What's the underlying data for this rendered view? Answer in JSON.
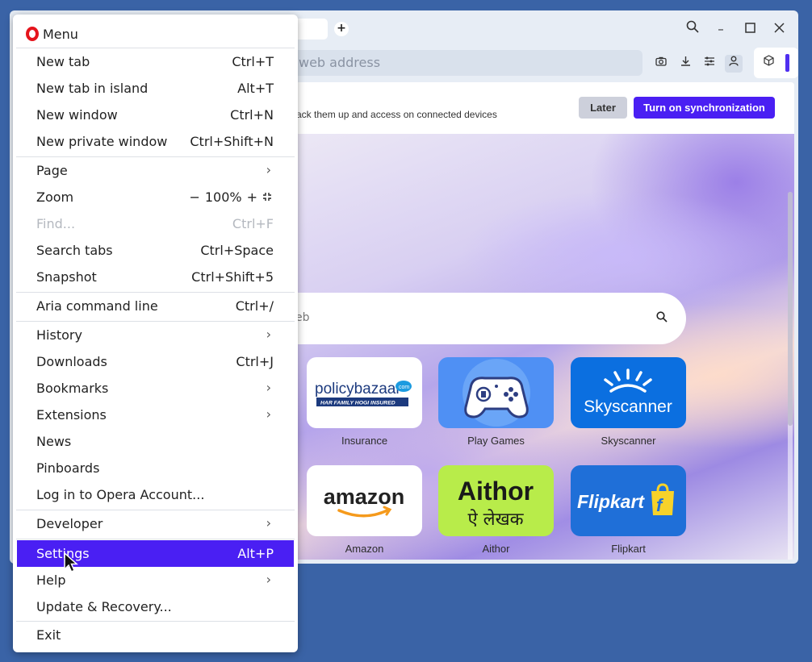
{
  "address_bar": {
    "placeholder": "web address"
  },
  "window_controls": {
    "search": "⌕",
    "minimize": "–",
    "maximize": "☐",
    "close": "✕"
  },
  "new_tab_symbol": "+",
  "sync_banner": {
    "text": "ack them up and access on connected devices",
    "later": "Later",
    "turn_on": "Turn on synchronization"
  },
  "search": {
    "placeholder": "eb"
  },
  "speed_dial": [
    {
      "label": "Insurance",
      "logo": "policybazaar",
      "logo_sub": "HAR FAMILY HOGI INSURED",
      "logo_com": "com"
    },
    {
      "label": "Play Games",
      "logo": "gamepad"
    },
    {
      "label": "Skyscanner",
      "logo": "Skyscanner"
    },
    {
      "label": "Amazon",
      "logo": "amazon"
    },
    {
      "label": "Aithor",
      "logo": "Aithor",
      "logo_sub": "ऐ लेखक"
    },
    {
      "label": "Flipkart",
      "logo": "Flipkart"
    }
  ],
  "menu": {
    "title": "Menu",
    "items": [
      {
        "label": "New tab",
        "shortcut": "Ctrl+T"
      },
      {
        "label": "New tab in island",
        "shortcut": "Alt+T"
      },
      {
        "label": "New window",
        "shortcut": "Ctrl+N"
      },
      {
        "label": "New private window",
        "shortcut": "Ctrl+Shift+N"
      },
      {
        "label": "Page",
        "shortcut": ""
      },
      {
        "label": "Zoom",
        "shortcut": ""
      },
      {
        "label": "Find...",
        "shortcut": "Ctrl+F"
      },
      {
        "label": "Search tabs",
        "shortcut": "Ctrl+Space"
      },
      {
        "label": "Snapshot",
        "shortcut": "Ctrl+Shift+5"
      },
      {
        "label": "Aria command line",
        "shortcut": "Ctrl+/"
      },
      {
        "label": "History",
        "shortcut": ""
      },
      {
        "label": "Downloads",
        "shortcut": "Ctrl+J"
      },
      {
        "label": "Bookmarks",
        "shortcut": ""
      },
      {
        "label": "Extensions",
        "shortcut": ""
      },
      {
        "label": "News",
        "shortcut": ""
      },
      {
        "label": "Pinboards",
        "shortcut": ""
      },
      {
        "label": "Log in to Opera Account...",
        "shortcut": ""
      },
      {
        "label": "Developer",
        "shortcut": ""
      },
      {
        "label": "Settings",
        "shortcut": "Alt+P"
      },
      {
        "label": "Help",
        "shortcut": ""
      },
      {
        "label": "Update & Recovery...",
        "shortcut": ""
      },
      {
        "label": "Exit",
        "shortcut": ""
      }
    ],
    "zoom": {
      "minus": "−",
      "value": "100%",
      "plus": "+",
      "fullscreen": "⛶"
    },
    "submenu_chevron": "›",
    "active_item": "Settings",
    "disabled_item": "Find..."
  },
  "colors": {
    "accent": "#4a1ff3",
    "desktop": "#3a63a6",
    "opera_red": "#e5141c"
  }
}
